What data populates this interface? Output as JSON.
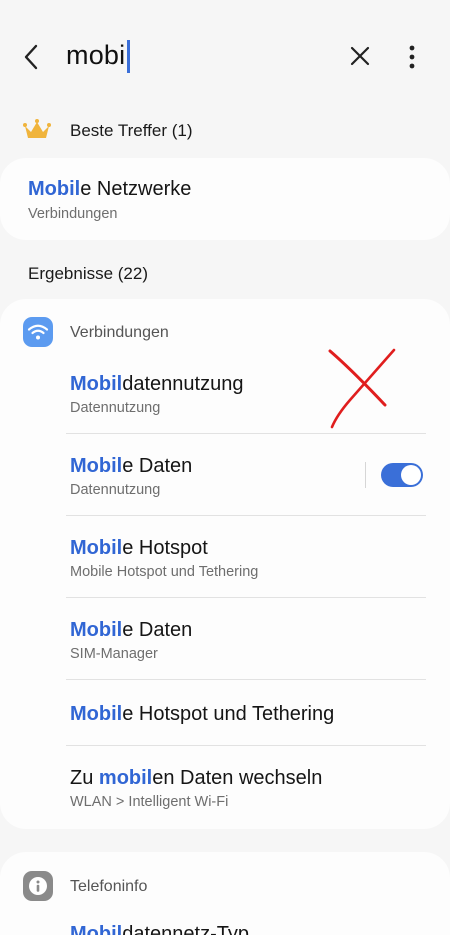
{
  "search": {
    "query": "mobil"
  },
  "best_hits": {
    "label": "Beste Treffer (1)",
    "item": {
      "title_hl": "Mobil",
      "title_rest": "e Netzwerke",
      "subtitle": "Verbindungen"
    }
  },
  "results": {
    "label": "Ergebnisse (22)",
    "categories": [
      {
        "label": "Verbindungen",
        "icon": "wifi-icon",
        "items": [
          {
            "title_pre": "",
            "title_hl": "Mobil",
            "title_rest": "datennutzung",
            "subtitle": "Datennutzung"
          },
          {
            "title_pre": "",
            "title_hl": "Mobil",
            "title_rest": "e Daten",
            "subtitle": "Datennutzung",
            "toggle_on": true
          },
          {
            "title_pre": "",
            "title_hl": "Mobil",
            "title_rest": "e Hotspot",
            "subtitle": "Mobile Hotspot und Tethering"
          },
          {
            "title_pre": "",
            "title_hl": "Mobil",
            "title_rest": "e Daten",
            "subtitle": "SIM-Manager"
          },
          {
            "title_pre": "",
            "title_hl": "Mobil",
            "title_rest": "e Hotspot und Tethering",
            "subtitle": ""
          },
          {
            "title_pre": "Zu ",
            "title_hl": "mobil",
            "title_rest": "en Daten wechseln",
            "subtitle": "WLAN > Intelligent Wi-Fi"
          }
        ]
      },
      {
        "label": "Telefoninfo",
        "icon": "info-icon",
        "items": [
          {
            "title_pre": "",
            "title_hl": "Mobil",
            "title_rest": "datennetz-Typ",
            "subtitle": ""
          }
        ]
      }
    ]
  },
  "colors": {
    "highlight": "#3166d4",
    "toggle": "#3a6fd8",
    "crown": "#f0b43c",
    "wifi_icon_bg": "#5c9bf0",
    "info_icon_bg": "#8a8a8a",
    "annotation_cross": "#e01e1e"
  }
}
